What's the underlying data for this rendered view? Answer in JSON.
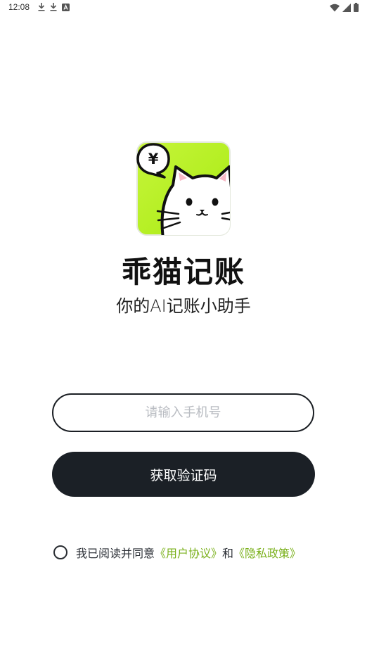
{
  "status_bar": {
    "time": "12:08",
    "left_icons": [
      "download-icon",
      "download-icon",
      "a-box-icon"
    ],
    "right_icons": [
      "wifi-icon",
      "cellular-signal-icon",
      "battery-icon"
    ]
  },
  "logo": {
    "bubble_symbol": "¥",
    "bg_color": "#b2f01c"
  },
  "app": {
    "name": "乖猫记账",
    "slogan": "你的AI记账小助手"
  },
  "login": {
    "phone_placeholder": "请输入手机号",
    "phone_value": "",
    "get_code_label": "获取验证码"
  },
  "agreement": {
    "checked": false,
    "prefix": "我已阅读并同意",
    "user_agreement": "《用户协议》",
    "conjunction": "和",
    "privacy_policy": "《隐私政策》",
    "link_color": "#7ab01b"
  }
}
